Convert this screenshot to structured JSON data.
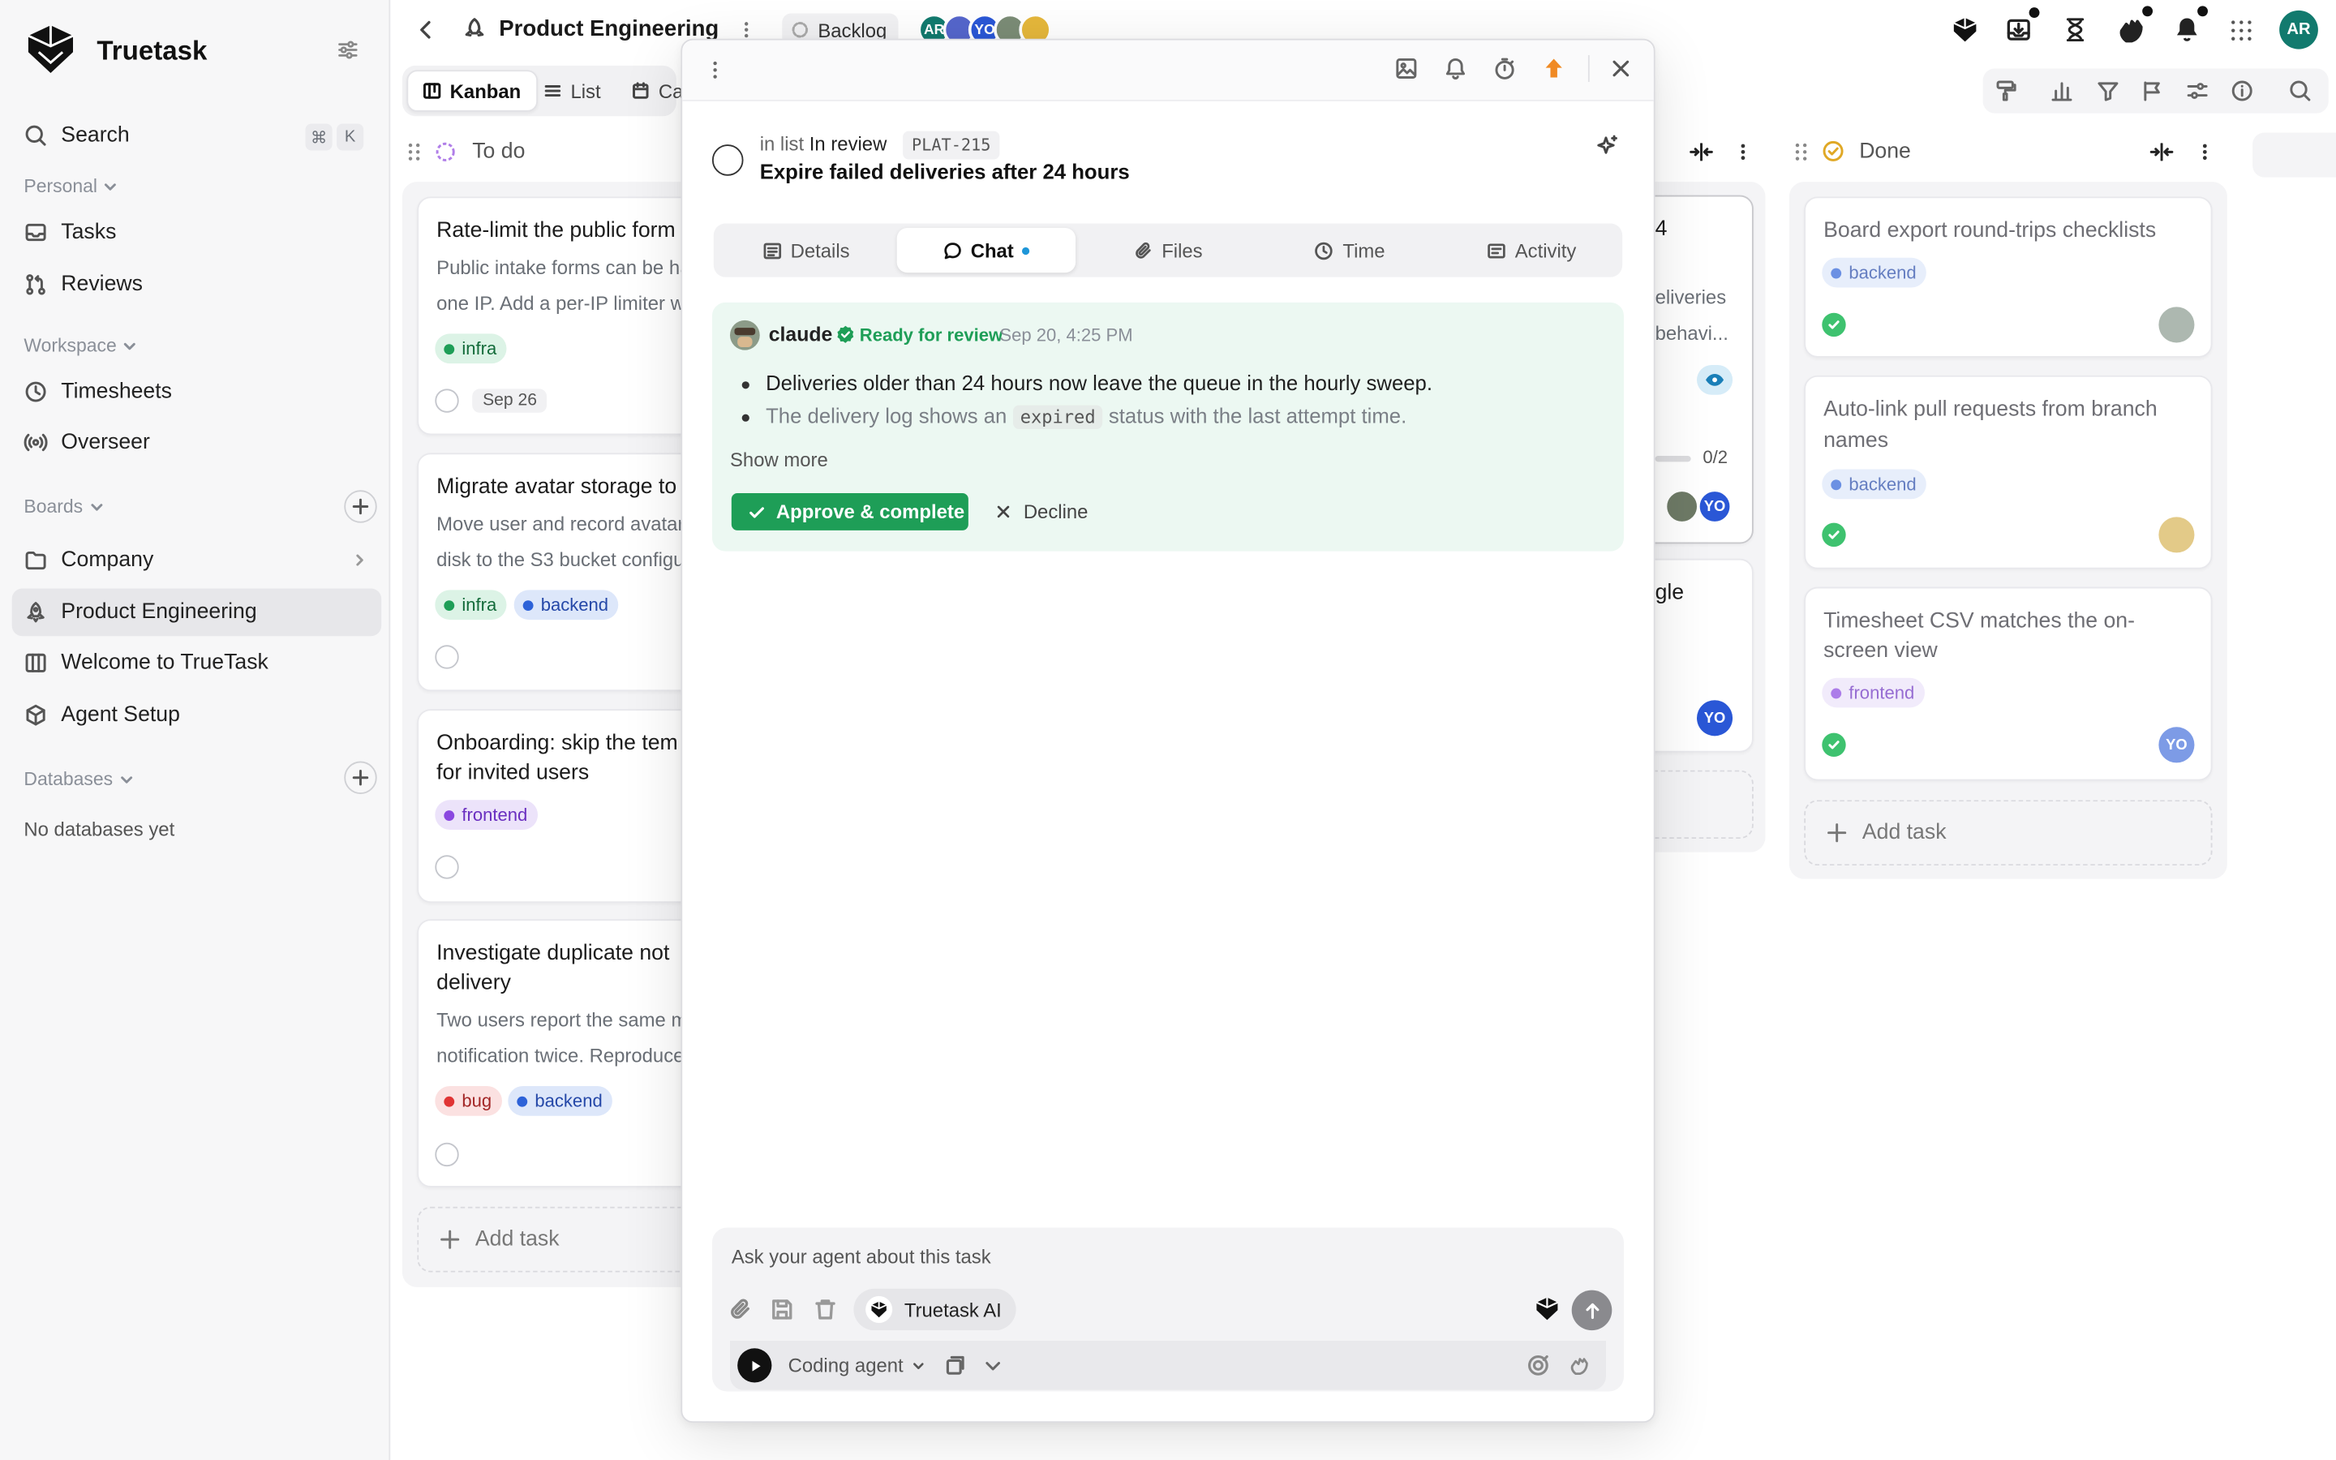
{
  "app": {
    "name": "Truetask",
    "user_initials": "AR"
  },
  "sidebar": {
    "search_label": "Search",
    "search_shortcut": [
      "⌘",
      "K"
    ],
    "personal_label": "Personal",
    "personal_items": [
      {
        "label": "Tasks",
        "icon": "inbox-icon"
      },
      {
        "label": "Reviews",
        "icon": "git-pull-request-icon"
      }
    ],
    "workspace_label": "Workspace",
    "workspace_items": [
      {
        "label": "Timesheets",
        "icon": "clock-icon"
      },
      {
        "label": "Overseer",
        "icon": "broadcast-icon"
      }
    ],
    "boards_label": "Boards",
    "board_items": [
      {
        "label": "Company",
        "icon": "folder-icon"
      },
      {
        "label": "Product Engineering",
        "icon": "rocket-icon",
        "active": true
      },
      {
        "label": "Welcome to TrueTask",
        "icon": "board-icon"
      },
      {
        "label": "Agent Setup",
        "icon": "cube-icon"
      }
    ],
    "databases_label": "Databases",
    "databases_empty": "No databases yet"
  },
  "header": {
    "board_title": "Product Engineering",
    "backlog_label": "Backlog",
    "member_initials": [
      "AR",
      "YO"
    ],
    "view_tabs": [
      "Kanban",
      "List",
      "Ca"
    ]
  },
  "columns": {
    "todo": {
      "title": "To do",
      "cards": [
        {
          "title": "Rate-limit the public form",
          "desc": [
            "Public intake forms can be ha",
            "one IP. Add a per-IP limiter wi"
          ],
          "tags": [
            "infra"
          ],
          "due": "Sep 26"
        },
        {
          "title": "Migrate avatar storage to",
          "desc": [
            "Move user and record avatars",
            "disk to the S3 bucket configu"
          ],
          "tags": [
            "infra",
            "backend"
          ]
        },
        {
          "title": [
            "Onboarding: skip the tem",
            "for invited users"
          ],
          "tags": [
            "frontend"
          ]
        },
        {
          "title": [
            "Investigate duplicate not",
            "delivery"
          ],
          "desc": [
            "Two users report the same m",
            "notification twice. Reproduce"
          ],
          "tags": [
            "bug",
            "backend"
          ]
        }
      ],
      "add_label": "Add task"
    },
    "review": {
      "card1": {
        "title_fragment": "4",
        "desc": [
          "eliveries",
          "behavi..."
        ],
        "progress": "0/2",
        "avatar": "YO"
      },
      "card2": {
        "title_fragment": "gle",
        "avatar": "YO"
      }
    },
    "done": {
      "title": "Done",
      "cards": [
        {
          "title": "Board export round-trips checklists",
          "tags": [
            "backend"
          ]
        },
        {
          "title": [
            "Auto-link pull requests from branch",
            "names"
          ],
          "tags": [
            "backend"
          ]
        },
        {
          "title": [
            "Timesheet CSV matches the on-",
            "screen view"
          ],
          "tags": [
            "frontend"
          ],
          "avatar": "YO"
        }
      ],
      "add_label": "Add task"
    }
  },
  "modal": {
    "list_prefix": "in list",
    "list_name": "In review",
    "task_id": "PLAT-215",
    "task_title": "Expire failed deliveries after 24 hours",
    "tabs": [
      "Details",
      "Chat",
      "Files",
      "Time",
      "Activity"
    ],
    "message": {
      "author": "claude",
      "status": "Ready for review",
      "time": "Sep 20, 4:25 PM",
      "bullet1": "Deliveries older than 24 hours now leave the queue in the hourly sweep.",
      "bullet2_pre": "The delivery log shows an",
      "bullet2_code": "expired",
      "bullet2_post": "status with the last attempt time.",
      "show_more": "Show more",
      "approve_label": "Approve & complete",
      "decline_label": "Decline"
    },
    "composer": {
      "placeholder": "Ask your agent about this task",
      "model_label": "Truetask AI",
      "agent_label": "Coding agent"
    }
  },
  "colors": {
    "accent_green": "#1e9e57",
    "chat_bg": "#ecf8f2",
    "tag_infra_bg": "#dcf3e6",
    "tag_backend_bg": "#dde7fa",
    "tag_frontend_bg": "#ece3fa",
    "tag_bug_bg": "#fbe1e1"
  }
}
